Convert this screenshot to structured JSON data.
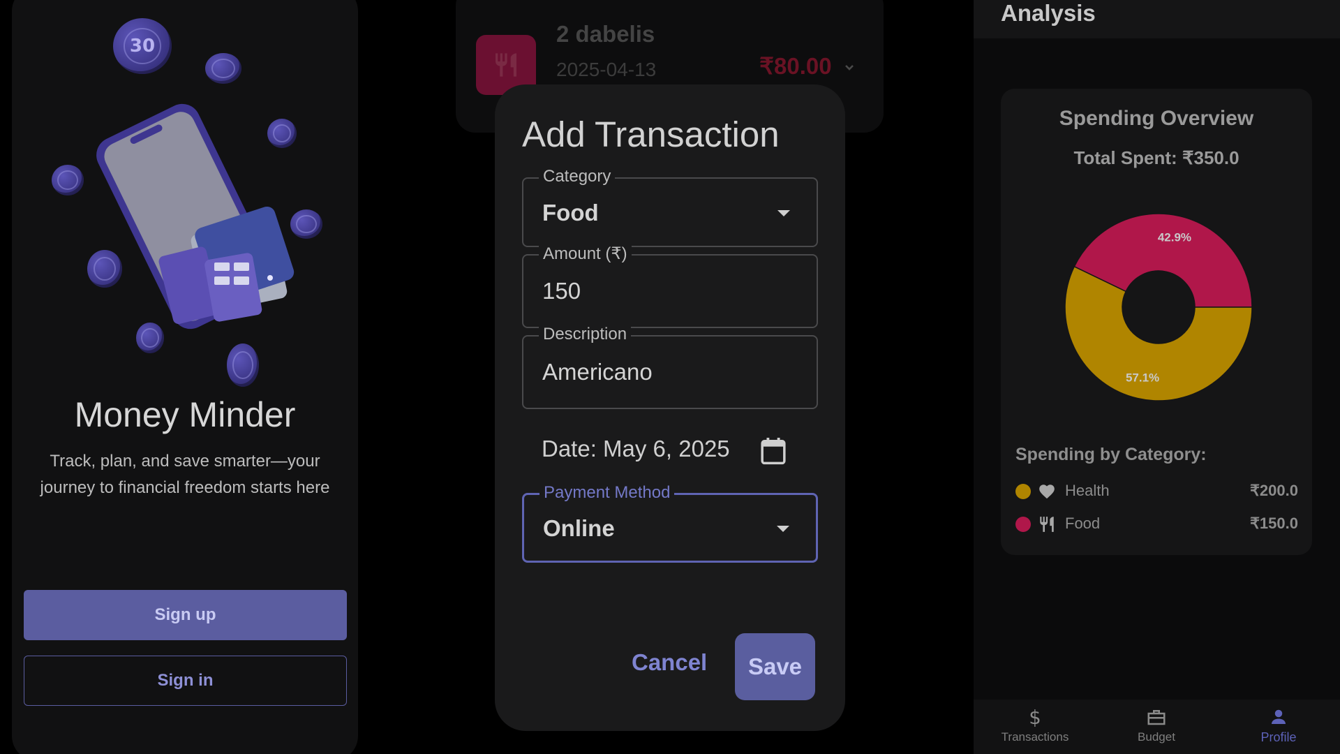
{
  "onboarding": {
    "title": "Money Minder",
    "tagline": "Track, plan, and save smarter—your journey to financial freedom starts here",
    "coin_badge": "30",
    "signup_label": "Sign up",
    "signin_label": "Sign in"
  },
  "background_transaction": {
    "name": "2 dabelis",
    "date": "2025-04-13",
    "amount": "₹80.00",
    "icon": "fork-knife-icon"
  },
  "dialog": {
    "title": "Add Transaction",
    "category": {
      "label": "Category",
      "value": "Food"
    },
    "amount": {
      "label": "Amount (₹)",
      "value": "150"
    },
    "description": {
      "label": "Description",
      "value": "Americano"
    },
    "date_text": "Date: May 6, 2025",
    "payment_method": {
      "label": "Payment Method",
      "value": "Online"
    },
    "cancel_label": "Cancel",
    "save_label": "Save"
  },
  "analysis": {
    "header_title": "Analysis",
    "overview_title": "Spending Overview",
    "total_spent": "Total Spent: ₹350.0",
    "by_category_label": "Spending by Category:",
    "categories": [
      {
        "name": "Health",
        "amount": "₹200.0",
        "color": "#b08500",
        "icon": "heart-icon"
      },
      {
        "name": "Food",
        "amount": "₹150.0",
        "color": "#b0174a",
        "icon": "fork-knife-icon"
      }
    ]
  },
  "chart_data": {
    "type": "pie",
    "title": "Spending Overview",
    "slices": [
      {
        "name": "Food",
        "value": 150,
        "percent": 42.9,
        "label": "42.9%",
        "color": "#b0174a"
      },
      {
        "name": "Health",
        "value": 200,
        "percent": 57.1,
        "label": "57.1%",
        "color": "#b08500"
      }
    ]
  },
  "nav": {
    "items": [
      {
        "label": "Transactions",
        "icon": "dollar-icon",
        "active": false
      },
      {
        "label": "Budget",
        "icon": "briefcase-icon",
        "active": false
      },
      {
        "label": "Profile",
        "icon": "person-icon",
        "active": true
      }
    ]
  }
}
